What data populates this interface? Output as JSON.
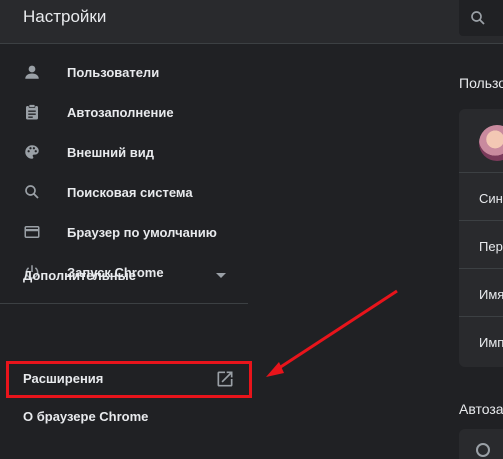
{
  "app": {
    "title": "Настройки"
  },
  "sidebar": {
    "items": [
      {
        "label": "Пользователи",
        "icon": "person-icon"
      },
      {
        "label": "Автозаполнение",
        "icon": "clipboard-icon"
      },
      {
        "label": "Внешний вид",
        "icon": "palette-icon"
      },
      {
        "label": "Поисковая система",
        "icon": "search-icon"
      },
      {
        "label": "Браузер по умолчанию",
        "icon": "browser-window-icon"
      },
      {
        "label": "Запуск Chrome",
        "icon": "power-icon"
      }
    ],
    "advanced_label": "Дополнительные",
    "extensions_label": "Расширения",
    "about_label": "О браузере Chrome"
  },
  "main": {
    "people_title": "Пользо",
    "rows": [
      "Син",
      "Пер",
      "Имя",
      "Имп"
    ],
    "autofill_title": "Автоза"
  },
  "colors": {
    "background": "#202124",
    "topbar": "#292a2d",
    "highlight_red": "#e8141b",
    "text": "#e8eaed",
    "icon_gray": "#9aa0a6"
  }
}
